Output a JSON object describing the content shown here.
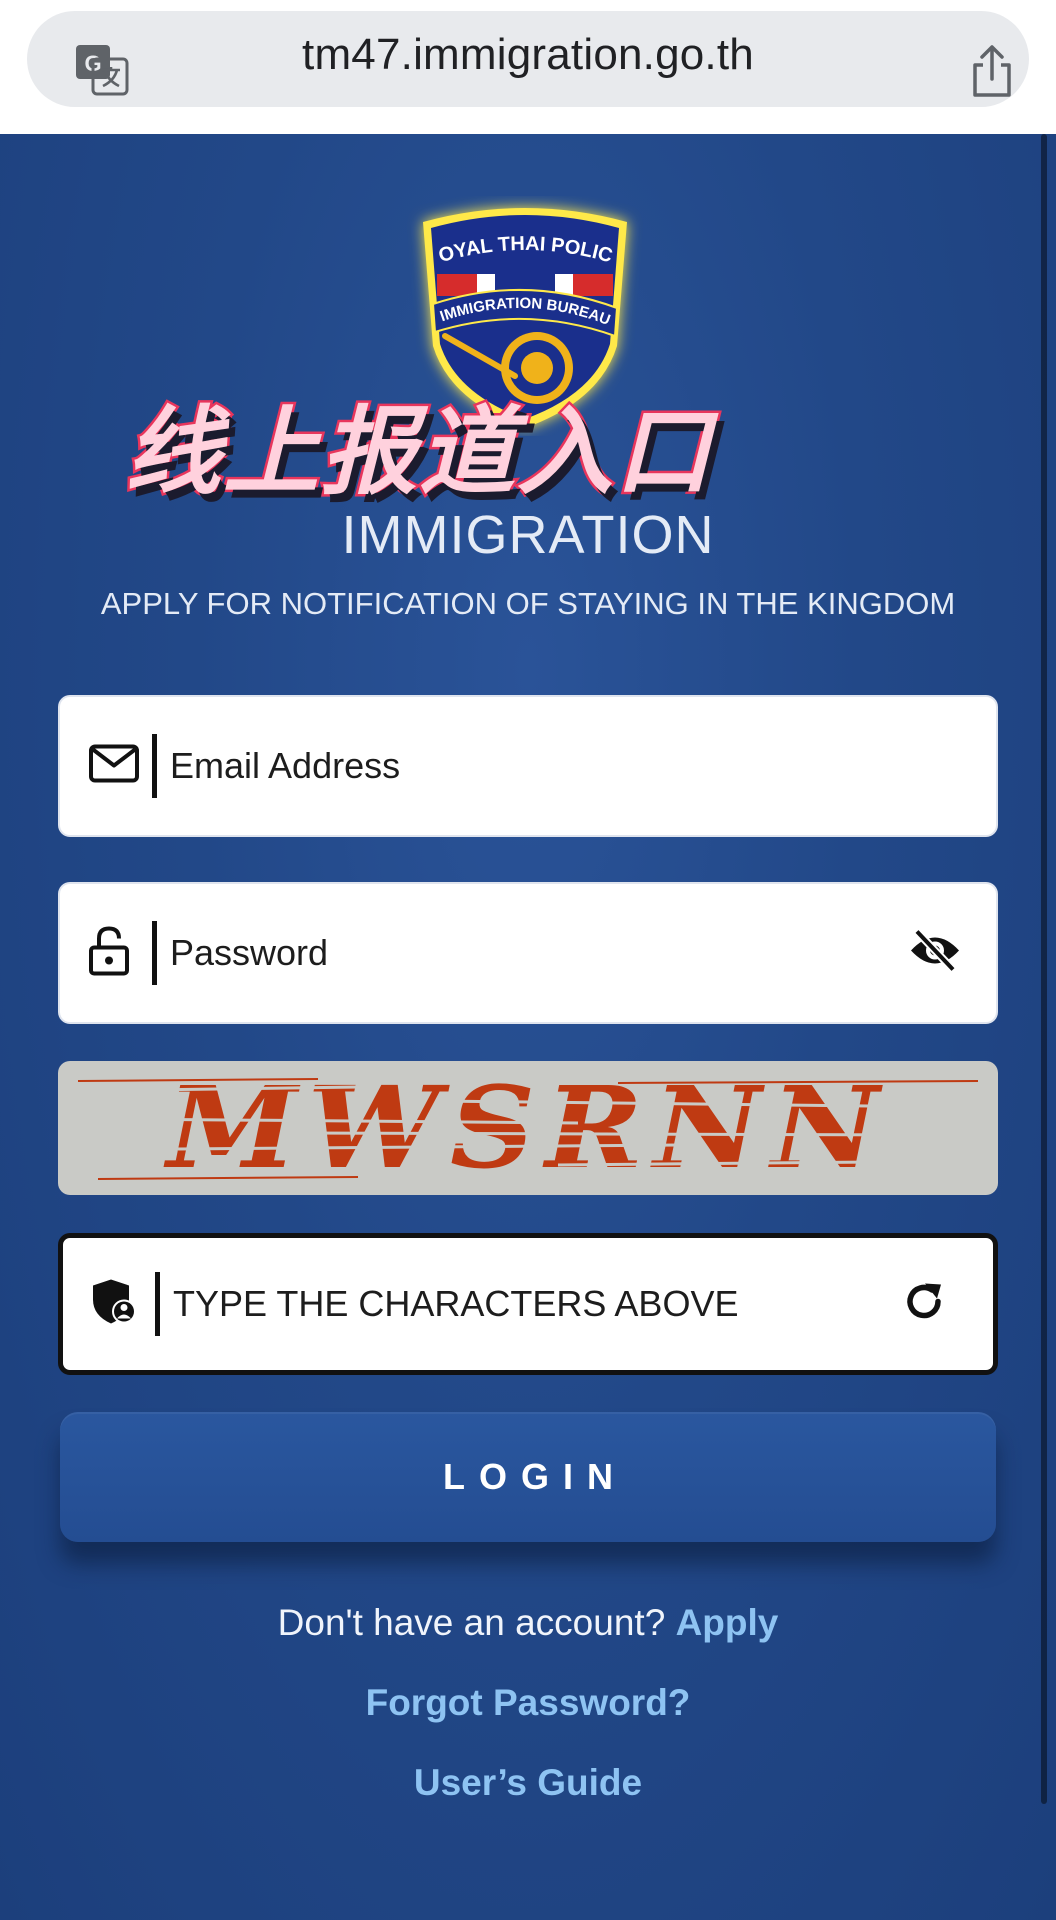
{
  "browser": {
    "url": "tm47.immigration.go.th",
    "icons": {
      "translate": "translate-icon",
      "share": "share-icon"
    }
  },
  "emblem": {
    "top_text": "ROYAL THAI POLICE",
    "band_text": "IMMIGRATION BUREAU"
  },
  "overlay_caption": "线上报道入口",
  "header": {
    "title": "IMMIGRATION",
    "subtitle": "APPLY FOR NOTIFICATION OF STAYING IN THE KINGDOM"
  },
  "form": {
    "email": {
      "placeholder": "Email Address",
      "icon": "envelope-icon"
    },
    "password": {
      "placeholder": "Password",
      "icon": "lock-icon",
      "toggle_icon": "eye-slash-icon"
    },
    "captcha": {
      "image_text": "MWSRNN",
      "placeholder": "TYPE THE CHARACTERS ABOVE",
      "icon": "shield-user-icon",
      "refresh_icon": "refresh-icon"
    },
    "login_label": "LOGIN"
  },
  "links": {
    "signup_prompt": "Don't have an account?",
    "apply": "Apply",
    "forgot": "Forgot Password?",
    "guide": "User’s Guide"
  },
  "colors": {
    "page_bg": "#224888",
    "link": "#8ec3f2",
    "caption_fill": "#ffd1dd",
    "caption_stroke": "#e8355c",
    "captcha_text": "#bf3a12"
  }
}
